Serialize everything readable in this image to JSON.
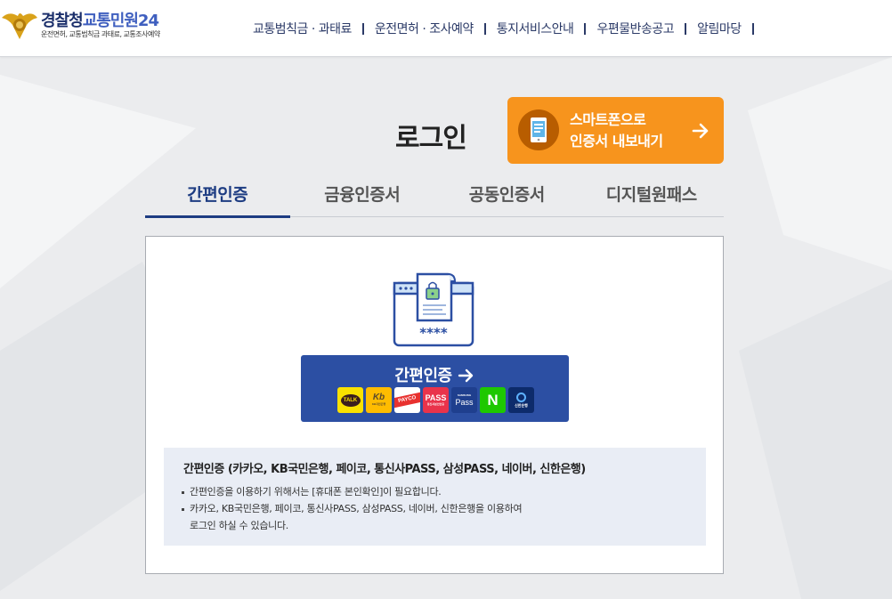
{
  "header": {
    "logo": {
      "title_part1": "경찰청",
      "title_part2": "교통민원24",
      "subtitle": "운전면허, 교통범칙금 과태료, 교통조사예약"
    },
    "nav": [
      {
        "label": "교통범칙금 · 과태료"
      },
      {
        "label": "운전면허 · 조사예약"
      },
      {
        "label": "통지서비스안내"
      },
      {
        "label": "우편물반송공고"
      },
      {
        "label": "알림마당"
      }
    ]
  },
  "page": {
    "title": "로그인",
    "smartphone_button": {
      "line1": "스마트폰으로",
      "line2": "인증서 내보내기"
    }
  },
  "tabs": [
    {
      "label": "간편인증",
      "active": true
    },
    {
      "label": "금융인증서",
      "active": false
    },
    {
      "label": "공동인증서",
      "active": false
    },
    {
      "label": "디지털원패스",
      "active": false
    }
  ],
  "panel": {
    "illustration": {
      "icon": "certificate-document-icon",
      "password_mask": "****"
    },
    "easy_auth_button": {
      "label": "간편인증",
      "providers": [
        {
          "name": "kakao",
          "label": "TALK",
          "color": "#fae100"
        },
        {
          "name": "kb",
          "label": "Kb",
          "sub": "KB국민은행",
          "color": "#ffbc00"
        },
        {
          "name": "payco",
          "label": "PAYCO",
          "color": "#e8312f"
        },
        {
          "name": "pass-telecom",
          "label": "PASS",
          "sub": "통신사본인인증",
          "color": "#e9334b"
        },
        {
          "name": "samsung-pass",
          "label": "Pass",
          "sub": "SAMSUNG",
          "color": "#1f3f8e"
        },
        {
          "name": "naver",
          "label": "N",
          "color": "#1ec800"
        },
        {
          "name": "shinhan",
          "label": "신한은행",
          "color": "#0d2b6b"
        }
      ]
    },
    "info": {
      "title": "간편인증 (카카오, KB국민은행, 페이코, 통신사PASS, 삼성PASS, 네이버, 신한은행)",
      "items": [
        {
          "lines": [
            "간편인증을 이용하기 위해서는 [휴대폰 본인확인]이 필요합니다."
          ]
        },
        {
          "lines": [
            "카카오, KB국민은행, 페이코, 통신사PASS, 삼성PASS, 네이버, 신한은행을 이용하여",
            "로그인 하실 수 있습니다."
          ]
        }
      ]
    }
  },
  "colors": {
    "brand_navy": "#1d3c82",
    "button_blue": "#2c4fa3",
    "accent_orange": "#f7941d"
  }
}
